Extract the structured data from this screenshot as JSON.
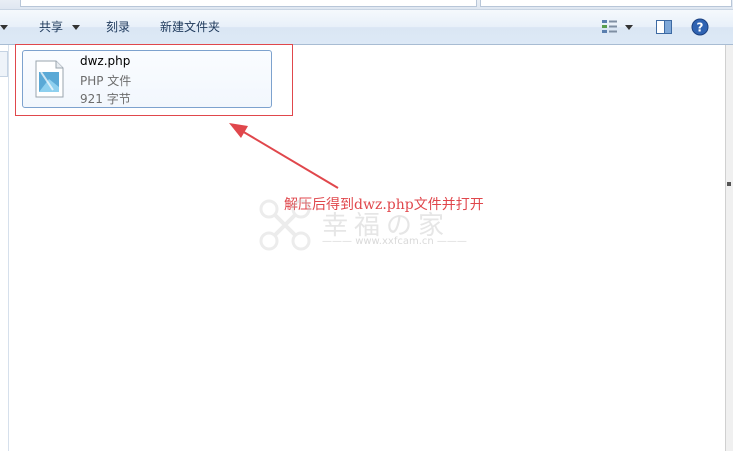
{
  "toolbar": {
    "share_label": "共享",
    "burn_label": "刻录",
    "new_folder_label": "新建文件夹"
  },
  "file": {
    "name": "dwz.php",
    "type": "PHP 文件",
    "size": "921 字节"
  },
  "annotation": {
    "text": "解压后得到dwz.php文件并打开",
    "color": "#e0474c"
  },
  "watermark": {
    "title": "幸福の家",
    "url": "www.xxfcam.cn"
  },
  "icons": [
    "view-options-icon",
    "preview-pane-icon",
    "help-icon",
    "php-file-icon",
    "dropdown-caret-icon",
    "watermark-logo-icon",
    "annotation-arrow-icon"
  ]
}
